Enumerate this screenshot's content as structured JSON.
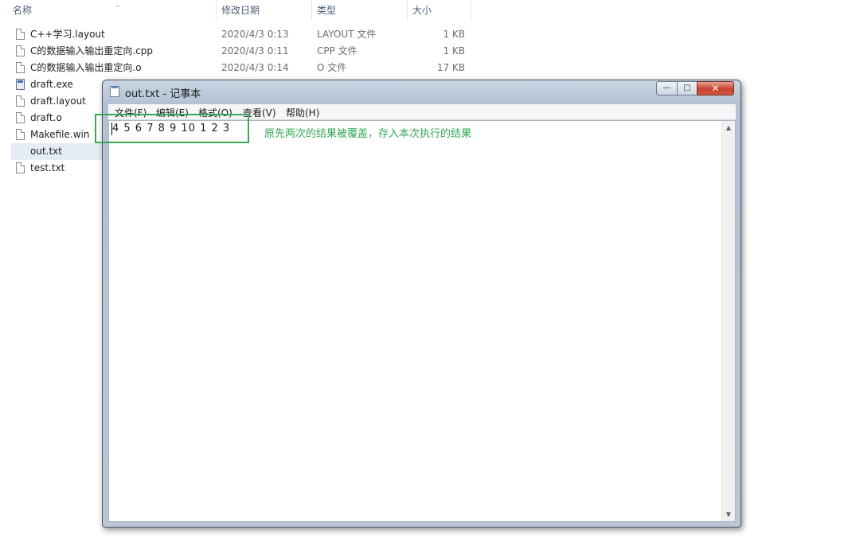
{
  "explorer": {
    "columns": {
      "name": "名称",
      "date": "修改日期",
      "type": "类型",
      "size": "大小"
    },
    "files": [
      {
        "name": "C++学习.layout",
        "date": "2020/4/3 0:13",
        "type": "LAYOUT 文件",
        "size": "1 KB",
        "icon": "document-icon"
      },
      {
        "name": "C的数据输入输出重定向.cpp",
        "date": "2020/4/3 0:11",
        "type": "CPP 文件",
        "size": "1 KB",
        "icon": "document-icon"
      },
      {
        "name": "C的数据输入输出重定向.o",
        "date": "2020/4/3 0:14",
        "type": "O 文件",
        "size": "17 KB",
        "icon": "document-icon"
      },
      {
        "name": "draft.exe",
        "date": "",
        "type": "",
        "size": "",
        "icon": "application-icon"
      },
      {
        "name": "draft.layout",
        "date": "",
        "type": "",
        "size": "",
        "icon": "document-icon"
      },
      {
        "name": "draft.o",
        "date": "",
        "type": "",
        "size": "",
        "icon": "document-icon"
      },
      {
        "name": "Makefile.win",
        "date": "",
        "type": "",
        "size": "",
        "icon": "document-icon"
      },
      {
        "name": "out.txt",
        "date": "",
        "type": "",
        "size": "",
        "icon": "text-file-icon",
        "selected": true
      },
      {
        "name": "test.txt",
        "date": "",
        "type": "",
        "size": "",
        "icon": "text-file-icon"
      }
    ]
  },
  "notepad": {
    "title": "out.txt - 记事本",
    "menu": {
      "file": "文件(F)",
      "edit": "编辑(E)",
      "format": "格式(O)",
      "view": "查看(V)",
      "help": "帮助(H)"
    },
    "content": "4 5 6 7 8 9 10 1 2 3",
    "buttons": {
      "minimize": "—",
      "maximize": "□",
      "close": "✕"
    }
  },
  "annotation": {
    "text": "原先两次的结果被覆盖，存入本次执行的结果",
    "color": "#31a852"
  }
}
